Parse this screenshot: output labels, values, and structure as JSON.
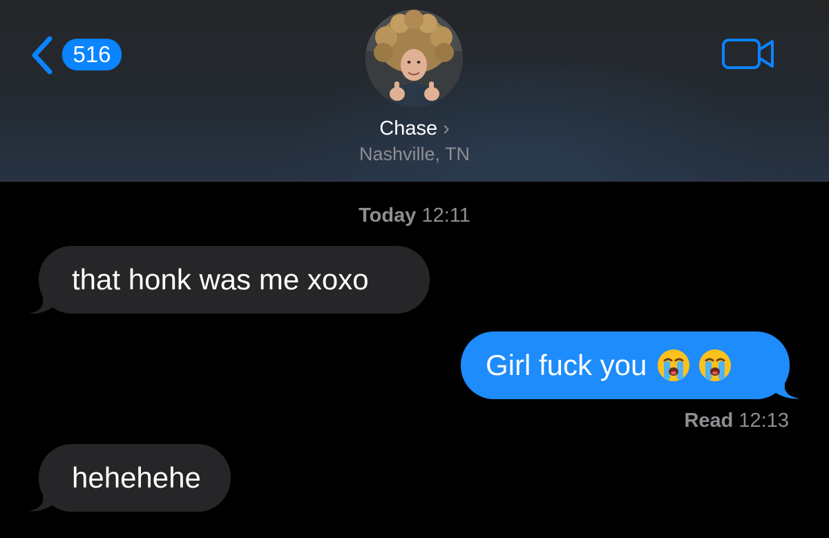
{
  "header": {
    "back_badge": "516",
    "contact_name": "Chase",
    "name_chevron": "›",
    "location": "Nashville, TN",
    "icons": {
      "back": "chevron-left-icon",
      "video": "video-camera-icon",
      "info": "chevron-right-icon"
    }
  },
  "conversation": {
    "timestamp_day": "Today",
    "timestamp_time": "12:11",
    "messages": [
      {
        "direction": "incoming",
        "text": "that honk was me xoxo"
      },
      {
        "direction": "outgoing",
        "text": "Girl fuck you",
        "emoji": [
          "loudly-crying-face",
          "loudly-crying-face"
        ]
      },
      {
        "direction": "incoming",
        "text": "hehehehe"
      }
    ],
    "read_label": "Read",
    "read_time": "12:13"
  },
  "colors": {
    "accent_blue": "#0a84ff",
    "outgoing_bubble": "#1e8cfb",
    "incoming_bubble": "#262628",
    "secondary_text": "#8e8e93",
    "background": "#000000"
  }
}
